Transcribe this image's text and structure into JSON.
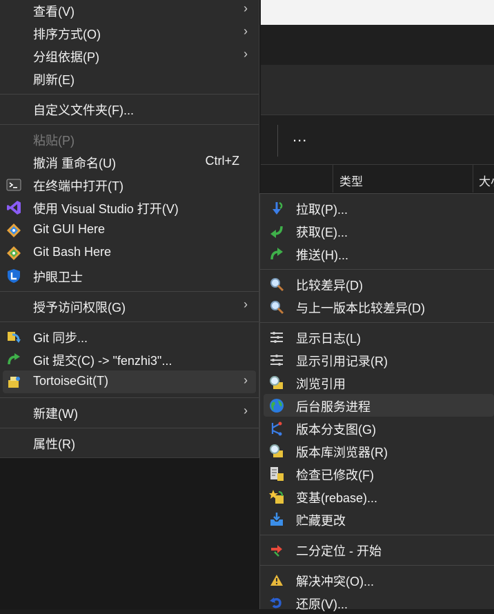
{
  "background": {
    "more_label": "...",
    "columns": [
      "类型",
      "大小"
    ]
  },
  "main_menu": {
    "view": "查看(V)",
    "sort": "排序方式(O)",
    "group": "分组依据(P)",
    "refresh": "刷新(E)",
    "customize": "自定义文件夹(F)...",
    "paste": "粘贴(P)",
    "undo": "撤消 重命名(U)",
    "undo_shortcut": "Ctrl+Z",
    "open_terminal": "在终端中打开(T)",
    "open_vs": "使用 Visual Studio 打开(V)",
    "git_gui": "Git GUI Here",
    "git_bash": "Git Bash Here",
    "eye_guard": "护眼卫士",
    "grant_access": "授予访问权限(G)",
    "git_sync": "Git 同步...",
    "git_commit": "Git 提交(C) -> \"fenzhi3\"...",
    "tortoisegit": "TortoiseGit(T)",
    "new": "新建(W)",
    "properties": "属性(R)"
  },
  "sub_menu": {
    "pull": "拉取(P)...",
    "fetch": "获取(E)...",
    "push": "推送(H)...",
    "diff": "比较差异(D)",
    "diff_prev": "与上一版本比较差异(D)",
    "show_log": "显示日志(L)",
    "reflog": "显示引用记录(R)",
    "browse_refs": "浏览引用",
    "daemon": "后台服务进程",
    "revision_graph": "版本分支图(G)",
    "repo_browser": "版本库浏览器(R)",
    "check_modifications": "检查已修改(F)",
    "rebase": "变基(rebase)...",
    "stash": "贮藏更改",
    "bisect": "二分定位 - 开始",
    "resolve": "解决冲突(O)...",
    "revert": "还原(V)..."
  },
  "colors": {
    "menu_bg": "#2c2c2c",
    "highlight": "#383838",
    "text": "#f2f2f2",
    "disabled_text": "#7a7a7a"
  }
}
